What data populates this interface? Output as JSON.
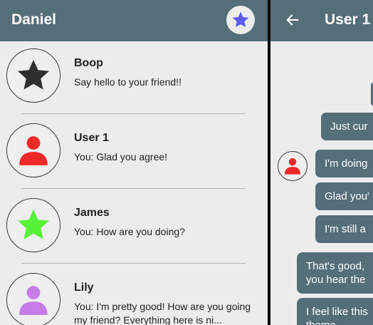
{
  "left": {
    "title": "Daniel",
    "conversations": [
      {
        "name": "Boop",
        "preview": "Say hello to your friend!!"
      },
      {
        "name": "User 1",
        "preview": "You: Glad you agree!"
      },
      {
        "name": "James",
        "preview": "You: How are you doing?"
      },
      {
        "name": "Lily",
        "preview": "You: I'm pretty good! How are you going my friend? Everything here is ni..."
      }
    ]
  },
  "right": {
    "title": "User 1",
    "messages": [
      {
        "text": "Just cur"
      },
      {
        "text": "I'm doing"
      },
      {
        "text": "Glad you'"
      },
      {
        "text": "I'm still a"
      },
      {
        "line1": "That's good,",
        "line2": "you hear the"
      },
      {
        "line1": "I feel like this",
        "line2": "theme"
      }
    ]
  },
  "colors": {
    "appbar": "#546e7a",
    "bubble": "#546e7a",
    "background": "#ececec",
    "star_button": "#5c5cf4",
    "boop_avatar": "#2e2e2e",
    "user1_avatar": "#f02828",
    "james_avatar": "#55f237",
    "lily_avatar": "#c77ce6"
  },
  "icons": {
    "back": "arrow-left-icon",
    "favorite": "star-icon",
    "person": "person-icon"
  }
}
